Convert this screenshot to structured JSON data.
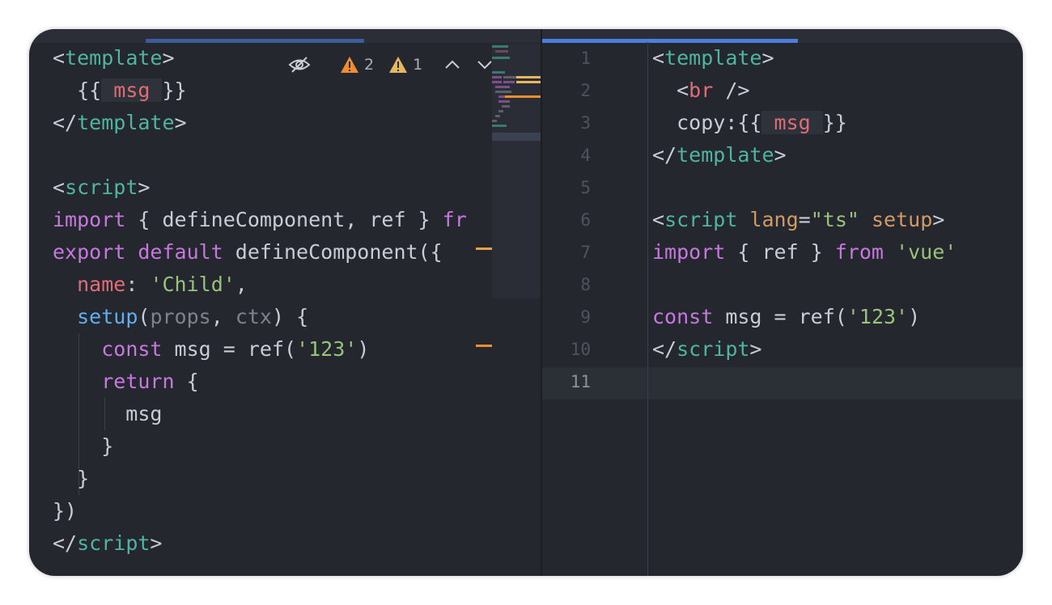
{
  "toolbar": {
    "errors_count": "2",
    "warnings_count": "1",
    "icons": [
      "eye-off-icon",
      "error-triangle-icon",
      "warning-triangle-icon",
      "chevron-up-icon",
      "chevron-down-icon"
    ]
  },
  "left_editor": {
    "lines": [
      [
        [
          "tk-punc",
          "<"
        ],
        [
          "tk-tag",
          "template"
        ],
        [
          "tk-punc",
          ">"
        ]
      ],
      [
        [
          "tk-punc",
          "  {{"
        ],
        [
          "tk-interp",
          " msg "
        ],
        [
          "tk-punc",
          "}}"
        ]
      ],
      [
        [
          "tk-punc",
          "</"
        ],
        [
          "tk-tag",
          "template"
        ],
        [
          "tk-punc",
          ">"
        ]
      ],
      [],
      [
        [
          "tk-punc",
          "<"
        ],
        [
          "tk-tag",
          "script"
        ],
        [
          "tk-punc",
          ">"
        ]
      ],
      [
        [
          "tk-kw",
          "import"
        ],
        [
          "tk-punc",
          " { defineComponent, ref } "
        ],
        [
          "tk-kw",
          "fr"
        ]
      ],
      [
        [
          "tk-kw",
          "export"
        ],
        [
          "tk-punc",
          " "
        ],
        [
          "tk-kw",
          "default"
        ],
        [
          "tk-punc",
          " defineComponent({"
        ]
      ],
      [
        [
          "tk-punc",
          "  "
        ],
        [
          "tk-prop",
          "name"
        ],
        [
          "tk-punc",
          ": "
        ],
        [
          "tk-str",
          "'Child'"
        ],
        [
          "tk-punc",
          ","
        ]
      ],
      [
        [
          "tk-punc",
          "  "
        ],
        [
          "tk-fn",
          "setup"
        ],
        [
          "tk-punc",
          "("
        ],
        [
          "tk-param",
          "props"
        ],
        [
          "tk-punc",
          ", "
        ],
        [
          "tk-param",
          "ctx"
        ],
        [
          "tk-punc",
          ") {"
        ]
      ],
      [
        [
          "tk-punc",
          "    "
        ],
        [
          "tk-kw",
          "const"
        ],
        [
          "tk-punc",
          " msg = ref("
        ],
        [
          "tk-str",
          "'123'"
        ],
        [
          "tk-punc",
          ")"
        ]
      ],
      [
        [
          "tk-punc",
          "    "
        ],
        [
          "tk-kw",
          "return"
        ],
        [
          "tk-punc",
          " {"
        ]
      ],
      [
        [
          "tk-punc",
          "      msg"
        ]
      ],
      [
        [
          "tk-punc",
          "    }"
        ]
      ],
      [
        [
          "tk-punc",
          "  }"
        ]
      ],
      [
        [
          "tk-punc",
          "})"
        ]
      ],
      [
        [
          "tk-punc",
          "</"
        ],
        [
          "tk-tag",
          "script"
        ],
        [
          "tk-punc",
          ">"
        ]
      ]
    ]
  },
  "right_editor": {
    "line_numbers": [
      "1",
      "2",
      "3",
      "4",
      "5",
      "6",
      "7",
      "8",
      "9",
      "10",
      "11"
    ],
    "active_line": "11",
    "lines": [
      [
        [
          "tk-punc",
          "<"
        ],
        [
          "tk-tag",
          "template"
        ],
        [
          "tk-punc",
          ">"
        ]
      ],
      [
        [
          "tk-punc",
          "  <"
        ],
        [
          "tk-prop",
          "br"
        ],
        [
          "tk-punc",
          " />"
        ]
      ],
      [
        [
          "tk-punc",
          "  copy:{{"
        ],
        [
          "tk-interp",
          " msg "
        ],
        [
          "tk-punc",
          "}}"
        ]
      ],
      [
        [
          "tk-punc",
          "</"
        ],
        [
          "tk-tag",
          "template"
        ],
        [
          "tk-punc",
          ">"
        ]
      ],
      [],
      [
        [
          "tk-punc",
          "<"
        ],
        [
          "tk-tag",
          "script"
        ],
        [
          "tk-punc",
          " "
        ],
        [
          "tk-attr",
          "lang"
        ],
        [
          "tk-punc",
          "="
        ],
        [
          "tk-str",
          "\"ts\""
        ],
        [
          "tk-punc",
          " "
        ],
        [
          "tk-attr",
          "setup"
        ],
        [
          "tk-punc",
          ">"
        ]
      ],
      [
        [
          "tk-kw",
          "import"
        ],
        [
          "tk-punc",
          " { ref } "
        ],
        [
          "tk-kw",
          "from"
        ],
        [
          "tk-punc",
          " "
        ],
        [
          "tk-str",
          "'vue'"
        ]
      ],
      [],
      [
        [
          "tk-kw",
          "const"
        ],
        [
          "tk-punc",
          " msg = ref("
        ],
        [
          "tk-str",
          "'123'"
        ],
        [
          "tk-punc",
          ")"
        ]
      ],
      [
        [
          "tk-punc",
          "</"
        ],
        [
          "tk-tag",
          "script"
        ],
        [
          "tk-punc",
          ">"
        ]
      ],
      []
    ]
  },
  "colors": {
    "background": "#24272e",
    "tag": "#4fb4a2",
    "keyword": "#c678dd",
    "string": "#98c379",
    "error": "#f08d2f",
    "warning": "#e5b860",
    "scroll_indicator": "#3e5b9a",
    "scroll_indicator_active": "#4a7fe0"
  }
}
